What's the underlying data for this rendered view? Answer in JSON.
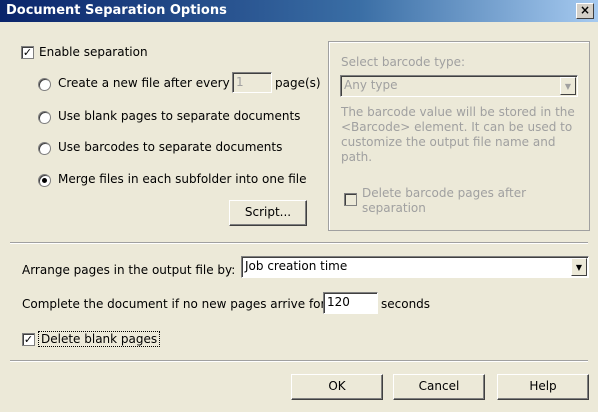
{
  "window": {
    "title": "Document Separation Options",
    "close_glyph": "×"
  },
  "separation": {
    "enable_label": "Enable separation",
    "enable_checked": true,
    "option_new_file_prefix": "Create a new file after every",
    "option_new_file_value": "1",
    "option_new_file_suffix": "page(s)",
    "option_blank_pages": "Use blank pages to separate documents",
    "option_barcodes": "Use barcodes to separate documents",
    "option_merge": "Merge files in each subfolder into one file",
    "selected_option": "merge",
    "script_button": "Script..."
  },
  "barcode": {
    "group_label": "Select barcode type:",
    "type_value": "Any type",
    "description": "The barcode value will be stored in the <Barcode> element. It can be used to customize the output file name and path.",
    "delete_label": "Delete barcode pages after separation",
    "delete_checked": false
  },
  "arrange": {
    "label": "Arrange pages in the output file by:",
    "value": "Job creation time"
  },
  "complete": {
    "prefix": "Complete the document if no new pages arrive for",
    "value": "120",
    "suffix": "seconds"
  },
  "delete_blank": {
    "label": "Delete blank pages",
    "checked": true
  },
  "buttons": {
    "ok": "OK",
    "cancel": "Cancel",
    "help": "Help"
  },
  "colors": {
    "title_bar": "#0a246a",
    "dialog_bg": "#ece9d8"
  }
}
